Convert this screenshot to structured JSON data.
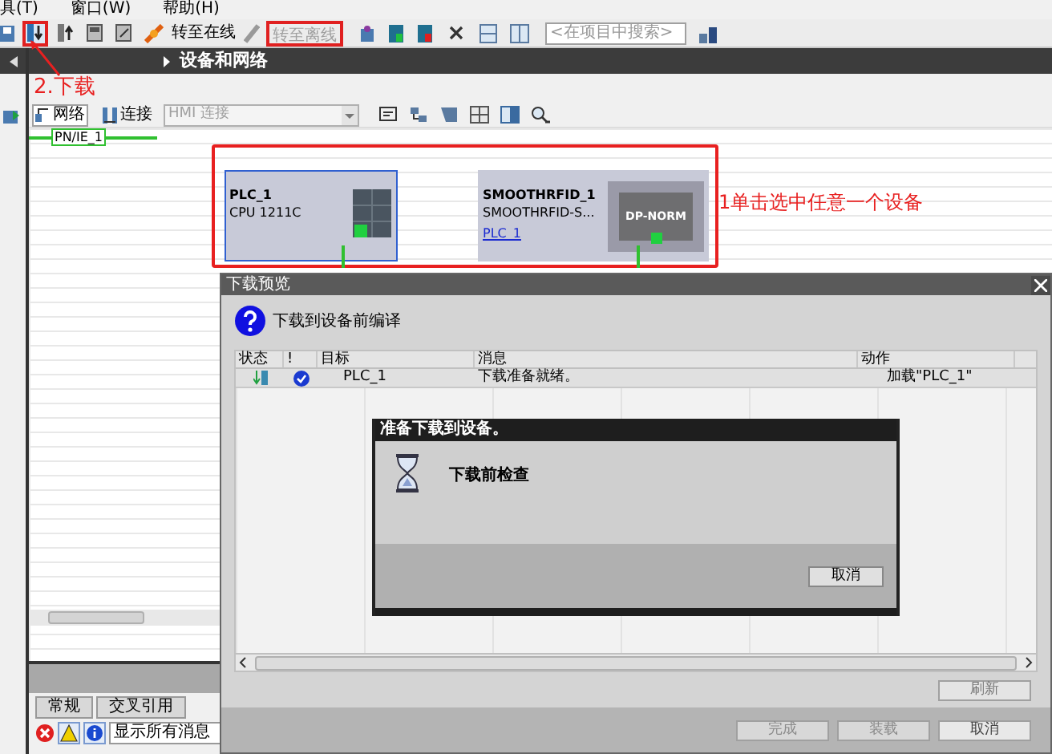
{
  "menu": [
    "具(T)",
    "窗口(W)",
    "帮助(H)"
  ],
  "toolbar": {
    "go_online": "转至在线",
    "go_offline": {
      "label": "转至离线",
      "disabled": true
    },
    "search": {
      "placeholder": "<在项目中搜索>"
    }
  },
  "breadcrumb": "设备和网络",
  "annotations": [
    {
      "text": "2.下载"
    },
    {
      "text": "1单击选中任意一个设备"
    }
  ],
  "network_toolbar": {
    "network": "网络",
    "connections": "连接",
    "connection_type": "HMI 连接"
  },
  "subnet": "PN/IE_1",
  "devices": [
    {
      "kind": "plc",
      "name": "PLC_1",
      "type": "CPU 1211C",
      "selected": true
    },
    {
      "kind": "io",
      "name": "SMOOTHRFID_1",
      "type": "SMOOTHRFID-S...",
      "link": "PLC_1",
      "module": "DP-NORM",
      "selected": false
    }
  ],
  "dialog": {
    "title": "下载预览",
    "prompt": "下载到设备前编译",
    "columns": [
      "状态",
      "!",
      "目标",
      "消息",
      "动作"
    ],
    "rows": [
      {
        "target": "PLC_1",
        "message": "下载准备就绪。",
        "action": "加载\"PLC_1\""
      }
    ],
    "refresh": "刷新",
    "buttons": [
      {
        "label": "完成",
        "disabled": true
      },
      {
        "label": "装载",
        "disabled": true
      },
      {
        "label": "取消",
        "disabled": false
      }
    ]
  },
  "progress": {
    "title": "准备下载到设备。",
    "message": "下载前检查",
    "cancel": "取消"
  },
  "inspector": {
    "tabs": [
      "常规",
      "交叉引用"
    ],
    "filter": "显示所有消息"
  }
}
